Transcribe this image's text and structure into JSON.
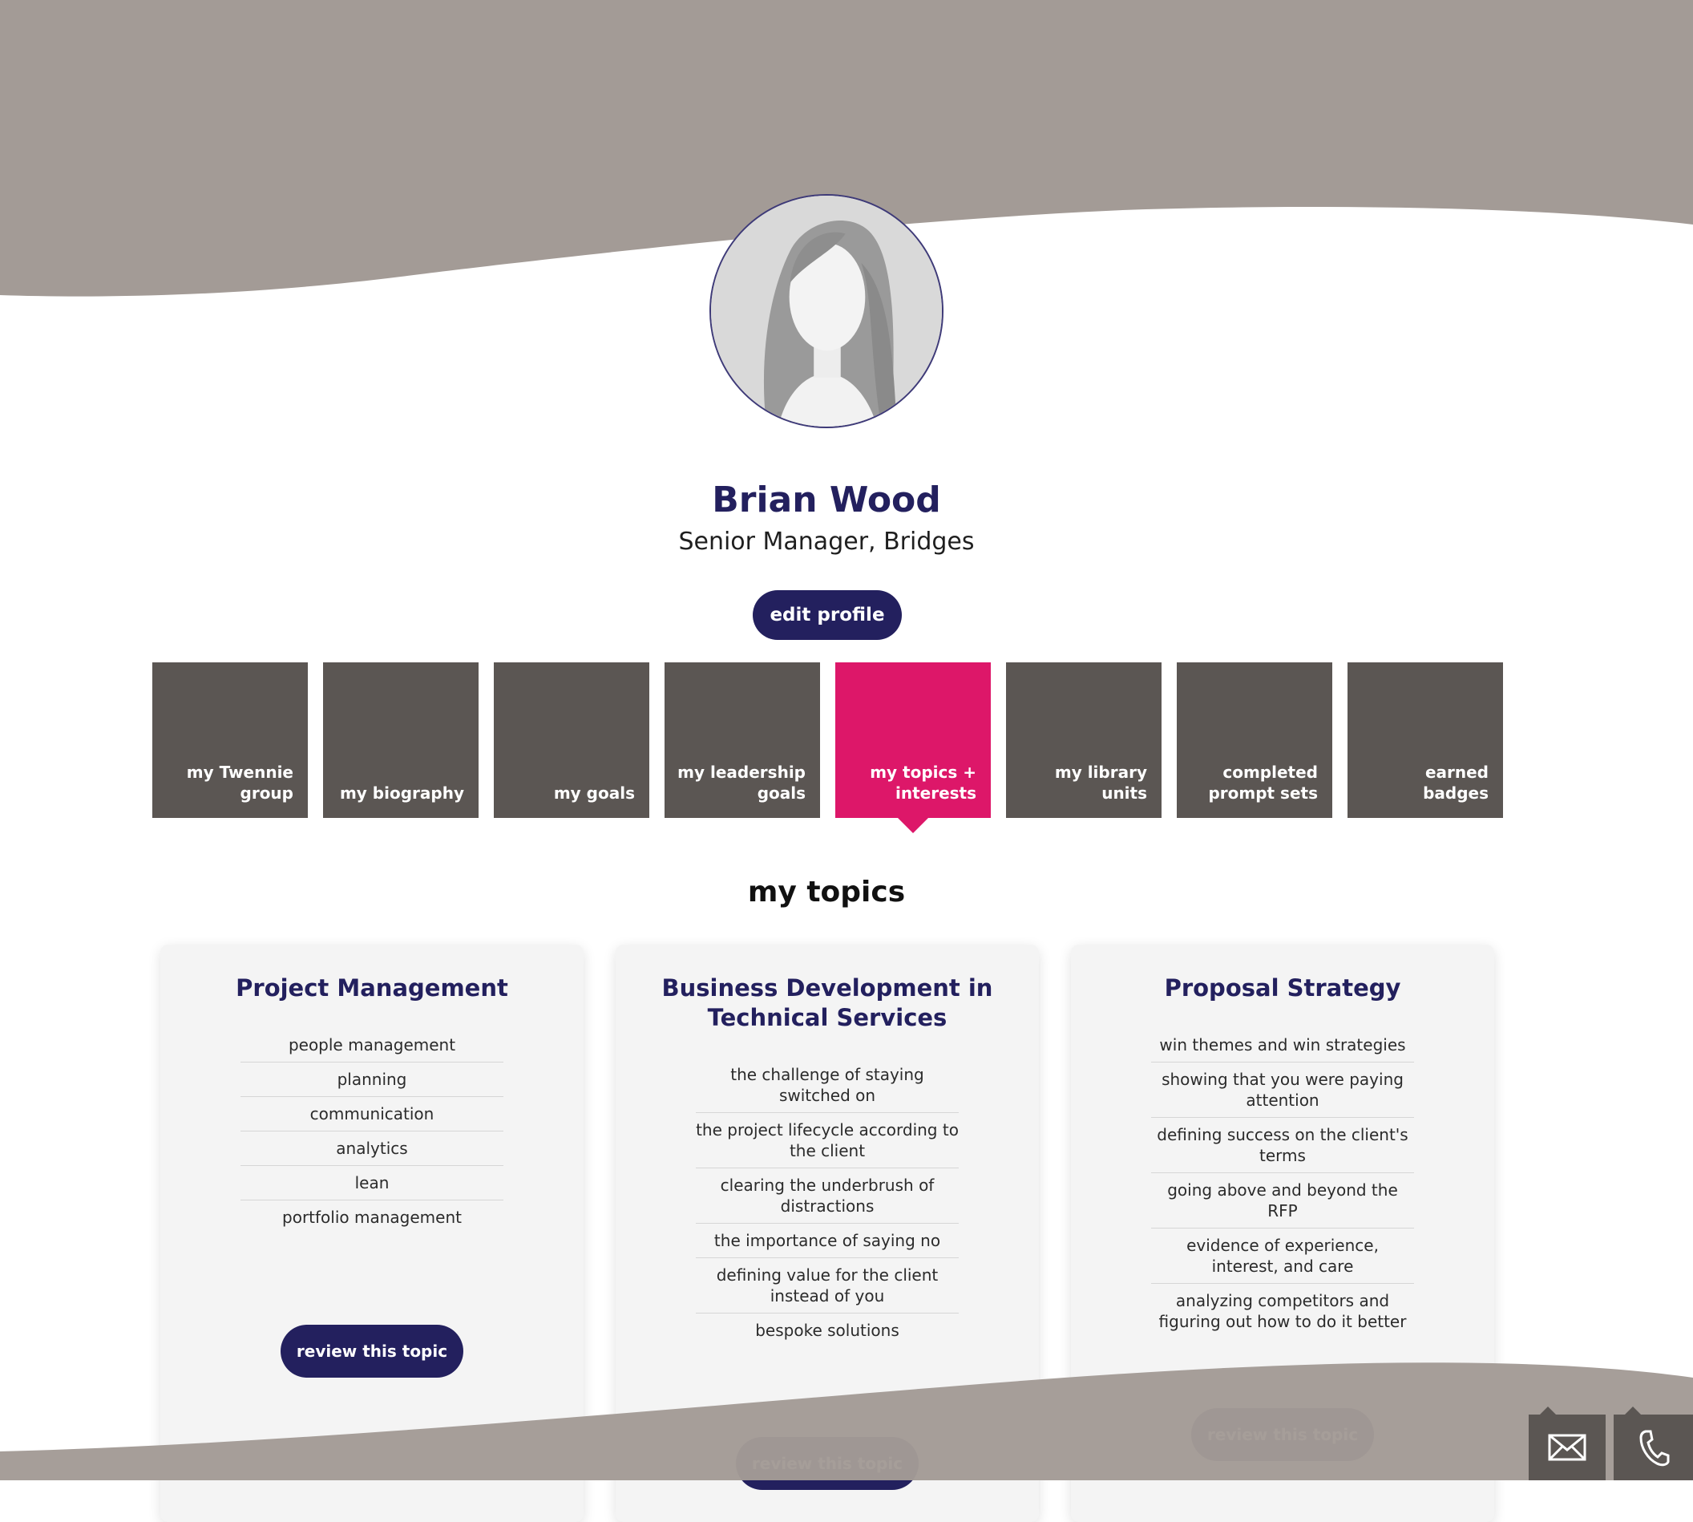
{
  "profile": {
    "name": "Brian Wood",
    "role": "Senior Manager, Bridges",
    "edit_label": "edit profile",
    "avatar_icon": "person-placeholder-icon"
  },
  "tabs": [
    {
      "label": "my Twennie group",
      "active": false
    },
    {
      "label": "my biography",
      "active": false
    },
    {
      "label": "my goals",
      "active": false
    },
    {
      "label": "my leadership goals",
      "active": false
    },
    {
      "label": "my topics + interests",
      "active": true
    },
    {
      "label": "my library units",
      "active": false
    },
    {
      "label": "completed prompt sets",
      "active": false
    },
    {
      "label": "earned badges",
      "active": false
    }
  ],
  "section": {
    "title": "my topics"
  },
  "cards": [
    {
      "title": "Project Management",
      "items": [
        "people management",
        "planning",
        "communication",
        "analytics",
        "lean",
        "portfolio management"
      ],
      "button": "review this topic"
    },
    {
      "title": "Business Development in Technical Services",
      "items": [
        "the challenge of staying switched on",
        "the project lifecycle according to the client",
        "clearing the underbrush of distractions",
        "the importance of saying no",
        "defining value for the client instead of you",
        "bespoke solutions"
      ],
      "button": "review this topic"
    },
    {
      "title": "Proposal Strategy",
      "items": [
        "win themes and win strategies",
        "showing that you were paying attention",
        "defining success on the client's terms",
        "going above and beyond the RFP",
        "evidence of experience, interest, and care",
        "analyzing competitors and figuring out how to do it better"
      ],
      "button": "review this topic"
    }
  ],
  "contact": {
    "email_icon": "envelope-icon",
    "phone_icon": "phone-icon"
  },
  "colors": {
    "accent": "#dd1769",
    "brand": "#23205e",
    "tile": "#5b5653",
    "wave": "#a39b96"
  }
}
